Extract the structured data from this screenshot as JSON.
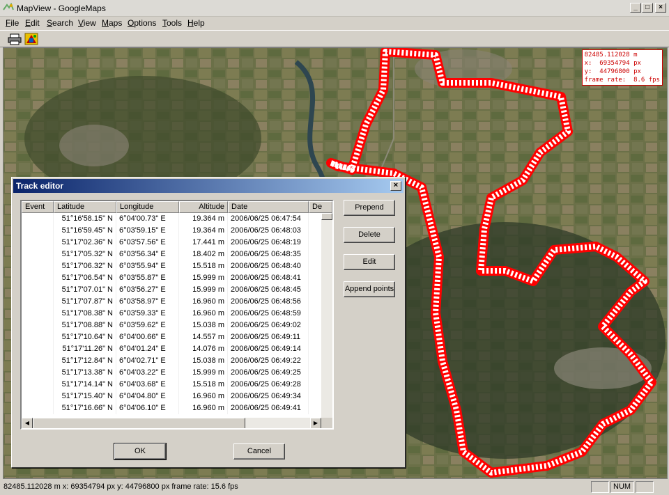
{
  "window": {
    "title": "MapView - GoogleMaps",
    "controls": {
      "minimize": "_",
      "maximize": "□",
      "close": "×"
    }
  },
  "menubar": {
    "items": [
      "File",
      "Edit",
      "Search",
      "View",
      "Maps",
      "Options",
      "Tools",
      "Help"
    ]
  },
  "toolbar": {
    "buttons": [
      "printer-icon",
      "maps-icon"
    ]
  },
  "map": {
    "readout": "82485.112028 m\nx:  69354794 px\ny:  44796800 px\nframe rate:  8.6 fps",
    "track_color": "#ff0000"
  },
  "statusbar": {
    "text": "82485.112028 m x:  69354794 px y:  44796800 px frame rate: 15.6 fps",
    "panel_num": "NUM"
  },
  "dialog": {
    "title": "Track editor",
    "close": "×",
    "columns": [
      "Event",
      "Latitude",
      "Longitude",
      "Altitude",
      "Date",
      "De"
    ],
    "rows": [
      [
        "",
        "51°16'58.15\" N",
        "6°04'00.73\" E",
        "19.364 m",
        "2006/06/25 06:47:54"
      ],
      [
        "",
        "51°16'59.45\" N",
        "6°03'59.15\" E",
        "19.364 m",
        "2006/06/25 06:48:03"
      ],
      [
        "",
        "51°17'02.36\" N",
        "6°03'57.56\" E",
        "17.441 m",
        "2006/06/25 06:48:19"
      ],
      [
        "",
        "51°17'05.32\" N",
        "6°03'56.34\" E",
        "18.402 m",
        "2006/06/25 06:48:35"
      ],
      [
        "",
        "51°17'06.32\" N",
        "6°03'55.94\" E",
        "15.518 m",
        "2006/06/25 06:48:40"
      ],
      [
        "",
        "51°17'06.54\" N",
        "6°03'55.87\" E",
        "15.999 m",
        "2006/06/25 06:48:41"
      ],
      [
        "",
        "51°17'07.01\" N",
        "6°03'56.27\" E",
        "15.999 m",
        "2006/06/25 06:48:45"
      ],
      [
        "",
        "51°17'07.87\" N",
        "6°03'58.97\" E",
        "16.960 m",
        "2006/06/25 06:48:56"
      ],
      [
        "",
        "51°17'08.38\" N",
        "6°03'59.33\" E",
        "16.960 m",
        "2006/06/25 06:48:59"
      ],
      [
        "",
        "51°17'08.88\" N",
        "6°03'59.62\" E",
        "15.038 m",
        "2006/06/25 06:49:02"
      ],
      [
        "",
        "51°17'10.64\" N",
        "6°04'00.66\" E",
        "14.557 m",
        "2006/06/25 06:49:11"
      ],
      [
        "",
        "51°17'11.26\" N",
        "6°04'01.24\" E",
        "14.076 m",
        "2006/06/25 06:49:14"
      ],
      [
        "",
        "51°17'12.84\" N",
        "6°04'02.71\" E",
        "15.038 m",
        "2006/06/25 06:49:22"
      ],
      [
        "",
        "51°17'13.38\" N",
        "6°04'03.22\" E",
        "15.999 m",
        "2006/06/25 06:49:25"
      ],
      [
        "",
        "51°17'14.14\" N",
        "6°04'03.68\" E",
        "15.518 m",
        "2006/06/25 06:49:28"
      ],
      [
        "",
        "51°17'15.40\" N",
        "6°04'04.80\" E",
        "16.960 m",
        "2006/06/25 06:49:34"
      ],
      [
        "",
        "51°17'16.66\" N",
        "6°04'06.10\" E",
        "16.960 m",
        "2006/06/25 06:49:41"
      ]
    ],
    "side_buttons": [
      "Prepend",
      "Delete",
      "Edit",
      "Append points"
    ],
    "ok": "OK",
    "cancel": "Cancel"
  }
}
